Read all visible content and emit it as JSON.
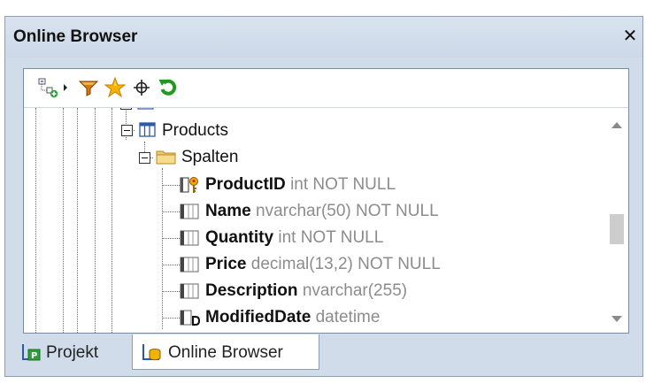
{
  "panel": {
    "title": "Online Browser",
    "close_label": "✕"
  },
  "toolbar": {
    "buttons": [
      {
        "icon": "add-connection-icon"
      },
      {
        "icon": "dropdown-arrow-icon"
      },
      {
        "icon": "filter-icon"
      },
      {
        "icon": "favorites-star-icon"
      },
      {
        "icon": "locate-crosshair-icon"
      },
      {
        "icon": "refresh-icon"
      }
    ]
  },
  "tree": {
    "table_label": "Products",
    "folder_label": "Spalten",
    "columns": [
      {
        "name": "ProductID",
        "type": "int NOT NULL",
        "icon": "primary-key-column-icon"
      },
      {
        "name": "Name",
        "type": "nvarchar(50) NOT NULL",
        "icon": "column-icon"
      },
      {
        "name": "Quantity",
        "type": "int NOT NULL",
        "icon": "column-icon"
      },
      {
        "name": "Price",
        "type": "decimal(13,2) NOT NULL",
        "icon": "column-icon"
      },
      {
        "name": "Description",
        "type": "nvarchar(255)",
        "icon": "column-icon"
      },
      {
        "name": "ModifiedDate",
        "type": "datetime",
        "icon": "default-column-icon"
      }
    ]
  },
  "tabs": [
    {
      "label": "Projekt",
      "active": false
    },
    {
      "label": "Online Browser",
      "active": true
    }
  ],
  "colors": {
    "titlebar": "#d1dceb",
    "border": "#8f9fb3",
    "type_text": "#8c8c8c",
    "refresh_green": "#1f9a1f",
    "filter_orange": "#d07a10",
    "star_yellow": "#f5b400"
  }
}
